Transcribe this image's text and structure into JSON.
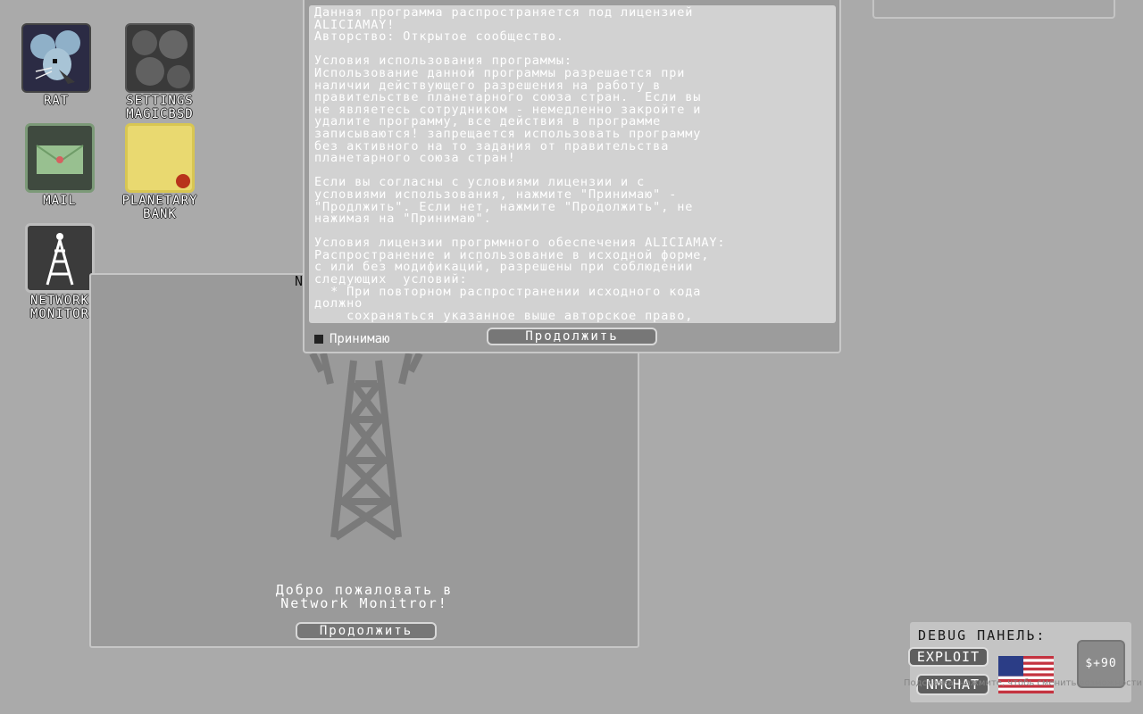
{
  "desktop": {
    "icons": [
      {
        "label": "RAT"
      },
      {
        "label": "SETTINGS\nMAGICBSD"
      },
      {
        "label": "MAIL"
      },
      {
        "label": "PLANETARY\nBANK"
      },
      {
        "label": "NETWORK\nMONITOR"
      }
    ]
  },
  "network_monitor": {
    "title_partial": "N",
    "welcome_text": "Добро пожаловать в\nNetwork Monitror!",
    "continue_label": "Продолжить"
  },
  "license_dialog": {
    "text": "Данная программа распространяется под лицензией\nALICIAMAY!\nАвторство: Открытое сообщество.\n\nУсловия использования программы:\nИспользование данной программы разрешается при\nналичии действующего разрешения на работу в\nправительстве планетарного союза стран.  Если вы\nне являетесь сотрудником - немедленно закройте и\nудалите программу, все действия в программе\nзаписываются! запрещается использовать программу\nбез активного на то задания от правительства\nпланетарного союза стран!\n\nЕсли вы согласны с условиями лицензии и с\nусловиями использования, нажмите \"Принимаю\" -\n\"Продлжить\". Если нет, нажмите \"Продолжить\", не\nнажимая на \"Принимаю\".\n\nУсловия лицензии прогрммного обеспечения ALICIAMAY:\nРаспространение и использование в исходной форме,\nс или без модификаций, разрешены при соблюдении\nследующих  условий:\n  * При повторном распространении исходного кода\nдолжно\n    сохраняться указанное выше авторское право,",
    "accept_label": "Принимаю",
    "continue_label": "Продолжить"
  },
  "debug_panel": {
    "title": "DEBUG ПАНЕЛЬ:",
    "exploit_label": "EXPLOIT",
    "nmchat_label": "NMCHAT",
    "money_label": "$+90",
    "hint": "Подсказка: нажмите, чтобь сменить возможности",
    "flag": "us-flag"
  },
  "colors": {
    "background": "#aaaaaa",
    "window": "#9a9a9a",
    "debug_panel": "#c4c4c4"
  }
}
